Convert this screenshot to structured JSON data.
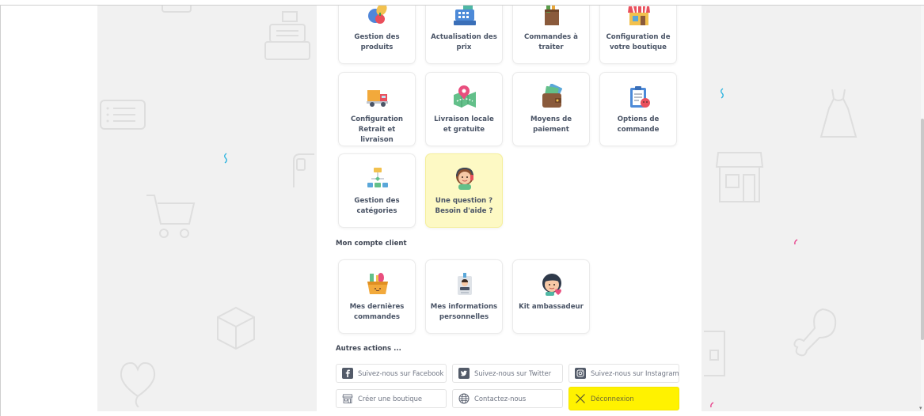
{
  "colors": {
    "help_card_bg": "#fdf9c4",
    "logout_bg": "#fff200",
    "label_text": "#4a5466",
    "backdrop": "#f1f1f1"
  },
  "shop_cards": [
    {
      "label": "Gestion des produits",
      "icon": "products-icon"
    },
    {
      "label": "Actualisation des prix",
      "icon": "cash-register-icon"
    },
    {
      "label": "Commandes à traiter",
      "icon": "shopping-bag-icon"
    },
    {
      "label": "Configuration de votre boutique",
      "icon": "storefront-icon"
    },
    {
      "label": "Configuration Retrait et livraison",
      "icon": "delivery-truck-icon"
    },
    {
      "label": "Livraison locale et gratuite",
      "icon": "map-pin-icon"
    },
    {
      "label": "Moyens de paiement",
      "icon": "wallet-icon"
    },
    {
      "label": "Options de commande",
      "icon": "clipboard-icon"
    },
    {
      "label": "Gestion des catégories",
      "icon": "category-tree-icon"
    },
    {
      "label": "Une question ? Besoin d'aide ?",
      "icon": "support-agent-icon"
    }
  ],
  "account": {
    "title": "Mon compte client",
    "cards": [
      {
        "label": "Mes dernières commandes",
        "icon": "basket-icon"
      },
      {
        "label": "Mes informations personnelles",
        "icon": "id-badge-icon"
      },
      {
        "label": "Kit ambassadeur",
        "icon": "ambassador-icon"
      }
    ]
  },
  "actions": {
    "title": "Autres actions ...",
    "buttons": [
      {
        "label": "Suivez-nous sur Facebook",
        "icon": "facebook-icon"
      },
      {
        "label": "Suivez-nous sur Twitter",
        "icon": "twitter-icon"
      },
      {
        "label": "Suivez-nous sur Instagram",
        "icon": "instagram-icon"
      },
      {
        "label": "Créer une boutique",
        "icon": "shop-outline-icon"
      },
      {
        "label": "Contactez-nous",
        "icon": "globe-icon"
      },
      {
        "label": "Déconnexion",
        "icon": "close-icon"
      }
    ]
  }
}
